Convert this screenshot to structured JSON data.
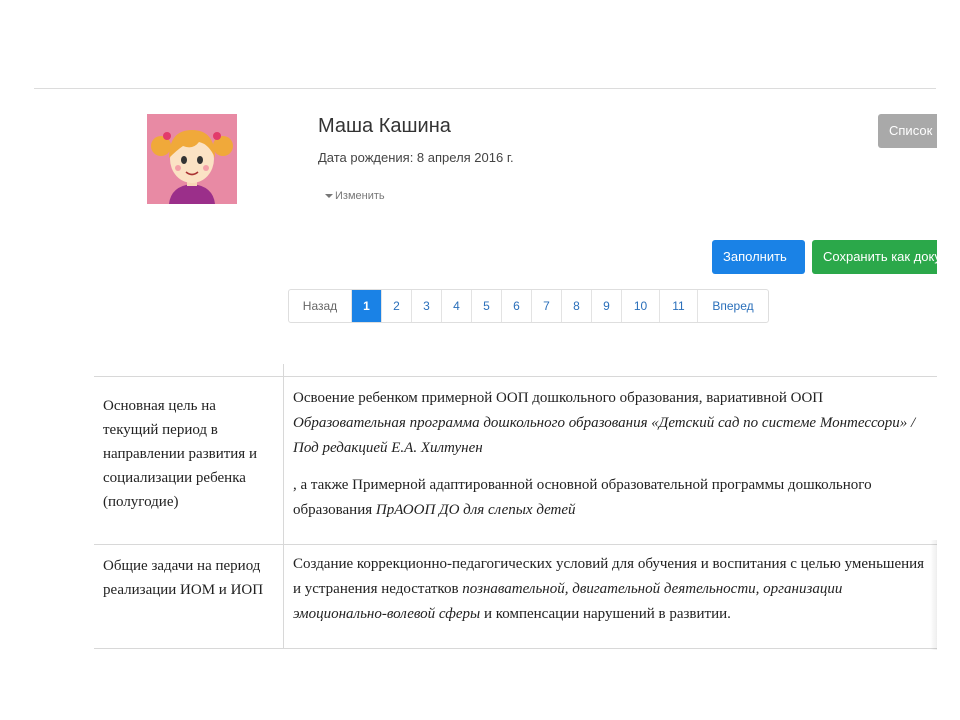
{
  "profile": {
    "name": "Маша Кашина",
    "dob": "Дата рождения: 8 апреля 2016 г.",
    "edit_label": "Изменить",
    "avatar_icon": "girl-avatar-icon"
  },
  "actions": {
    "list_label": "Список",
    "fill_label": "Заполнить",
    "save_label": "Сохранить как документ"
  },
  "pagination": {
    "back": "Назад",
    "forward": "Вперед",
    "pages": [
      "1",
      "2",
      "3",
      "4",
      "5",
      "6",
      "7",
      "8",
      "9",
      "10",
      "11"
    ],
    "active_page": "1"
  },
  "table": {
    "rows": [
      {
        "label": "Основная цель на текущий период в направлении развития и социализации ребенка (полугодие)",
        "line1": "Освоение ребенком примерной ООП дошкольного образования, вариативной ООП",
        "line2_italic": "Образовательная программа дошкольного образования «Детский сад по системе Монтессори» / Под редакцией Е.А. Хилтунен",
        "line3_plain": ", а также Примерной адаптированной основной образовательной программы дошкольного образования ",
        "line3_italic": "ПрАООП ДО для слепых детей"
      },
      {
        "label": "Общие задачи на период реализации ИОМ и ИОП",
        "part1": "Создание коррекционно-педагогических условий для обучения и воспитания с целью уменьшения и устранения недостатков ",
        "part2_italic": "познавательной, двигательной деятельности, организации эмоционально-волевой сферы",
        "part3": " и компенсации нарушений в развитии."
      }
    ]
  },
  "colors": {
    "primary": "#1a82e6",
    "success": "#2ba84a",
    "secondary": "#a9a9a9",
    "avatar_bg": "#e88aa4"
  }
}
